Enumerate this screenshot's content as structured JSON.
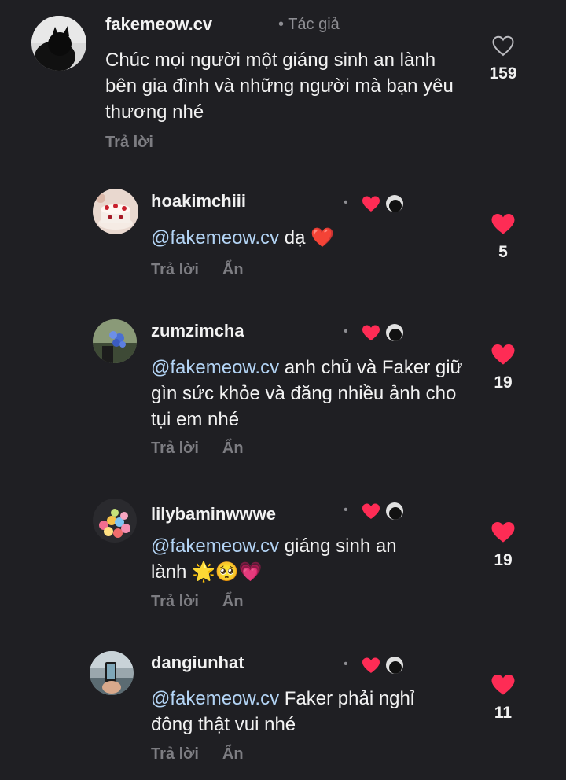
{
  "comments": [
    {
      "username": "fakemeow.cv",
      "author_tag": "Tác giả",
      "text": "Chúc mọi người một giáng sinh an lành bên gia đình và những người mà bạn yêu thương nhé",
      "reply_label": "Trả lời",
      "likes": "159",
      "liked": false,
      "avatar_icon": "black-cat-avatar"
    },
    {
      "username": "hoakimchiii",
      "mention": "@fakemeow.cv",
      "text": " dạ ",
      "emoji": "❤️",
      "reply_label": "Trả lời",
      "hide_label": "Ẩn",
      "likes": "5",
      "liked": true,
      "avatar_icon": "cake-avatar"
    },
    {
      "username": "zumzimcha",
      "mention": "@fakemeow.cv",
      "text": " anh chủ và Faker giữ gìn sức khỏe và đăng nhiều ảnh cho tụi em nhé",
      "reply_label": "Trả lời",
      "hide_label": "Ẩn",
      "likes": "19",
      "liked": true,
      "avatar_icon": "flower-avatar"
    },
    {
      "username": "lilybaminwwwe",
      "mention": "@fakemeow.cv",
      "text": " giáng sinh an lành ",
      "emoji": "🌟🥺💗",
      "reply_label": "Trả lời",
      "hide_label": "Ẩn",
      "likes": "19",
      "liked": true,
      "avatar_icon": "balloons-avatar"
    },
    {
      "username": "dangiunhat",
      "mention": "@fakemeow.cv",
      "text": " Faker phải nghỉ đông thật vui nhé",
      "reply_label": "Trả lời",
      "hide_label": "Ẩn",
      "likes": "11",
      "liked": true,
      "avatar_icon": "phone-photo-avatar"
    }
  ],
  "colors": {
    "background": "#1f1f23",
    "heart_red": "#fe2c55",
    "mention": "#b3d4f5",
    "muted": "#8e8e93"
  }
}
